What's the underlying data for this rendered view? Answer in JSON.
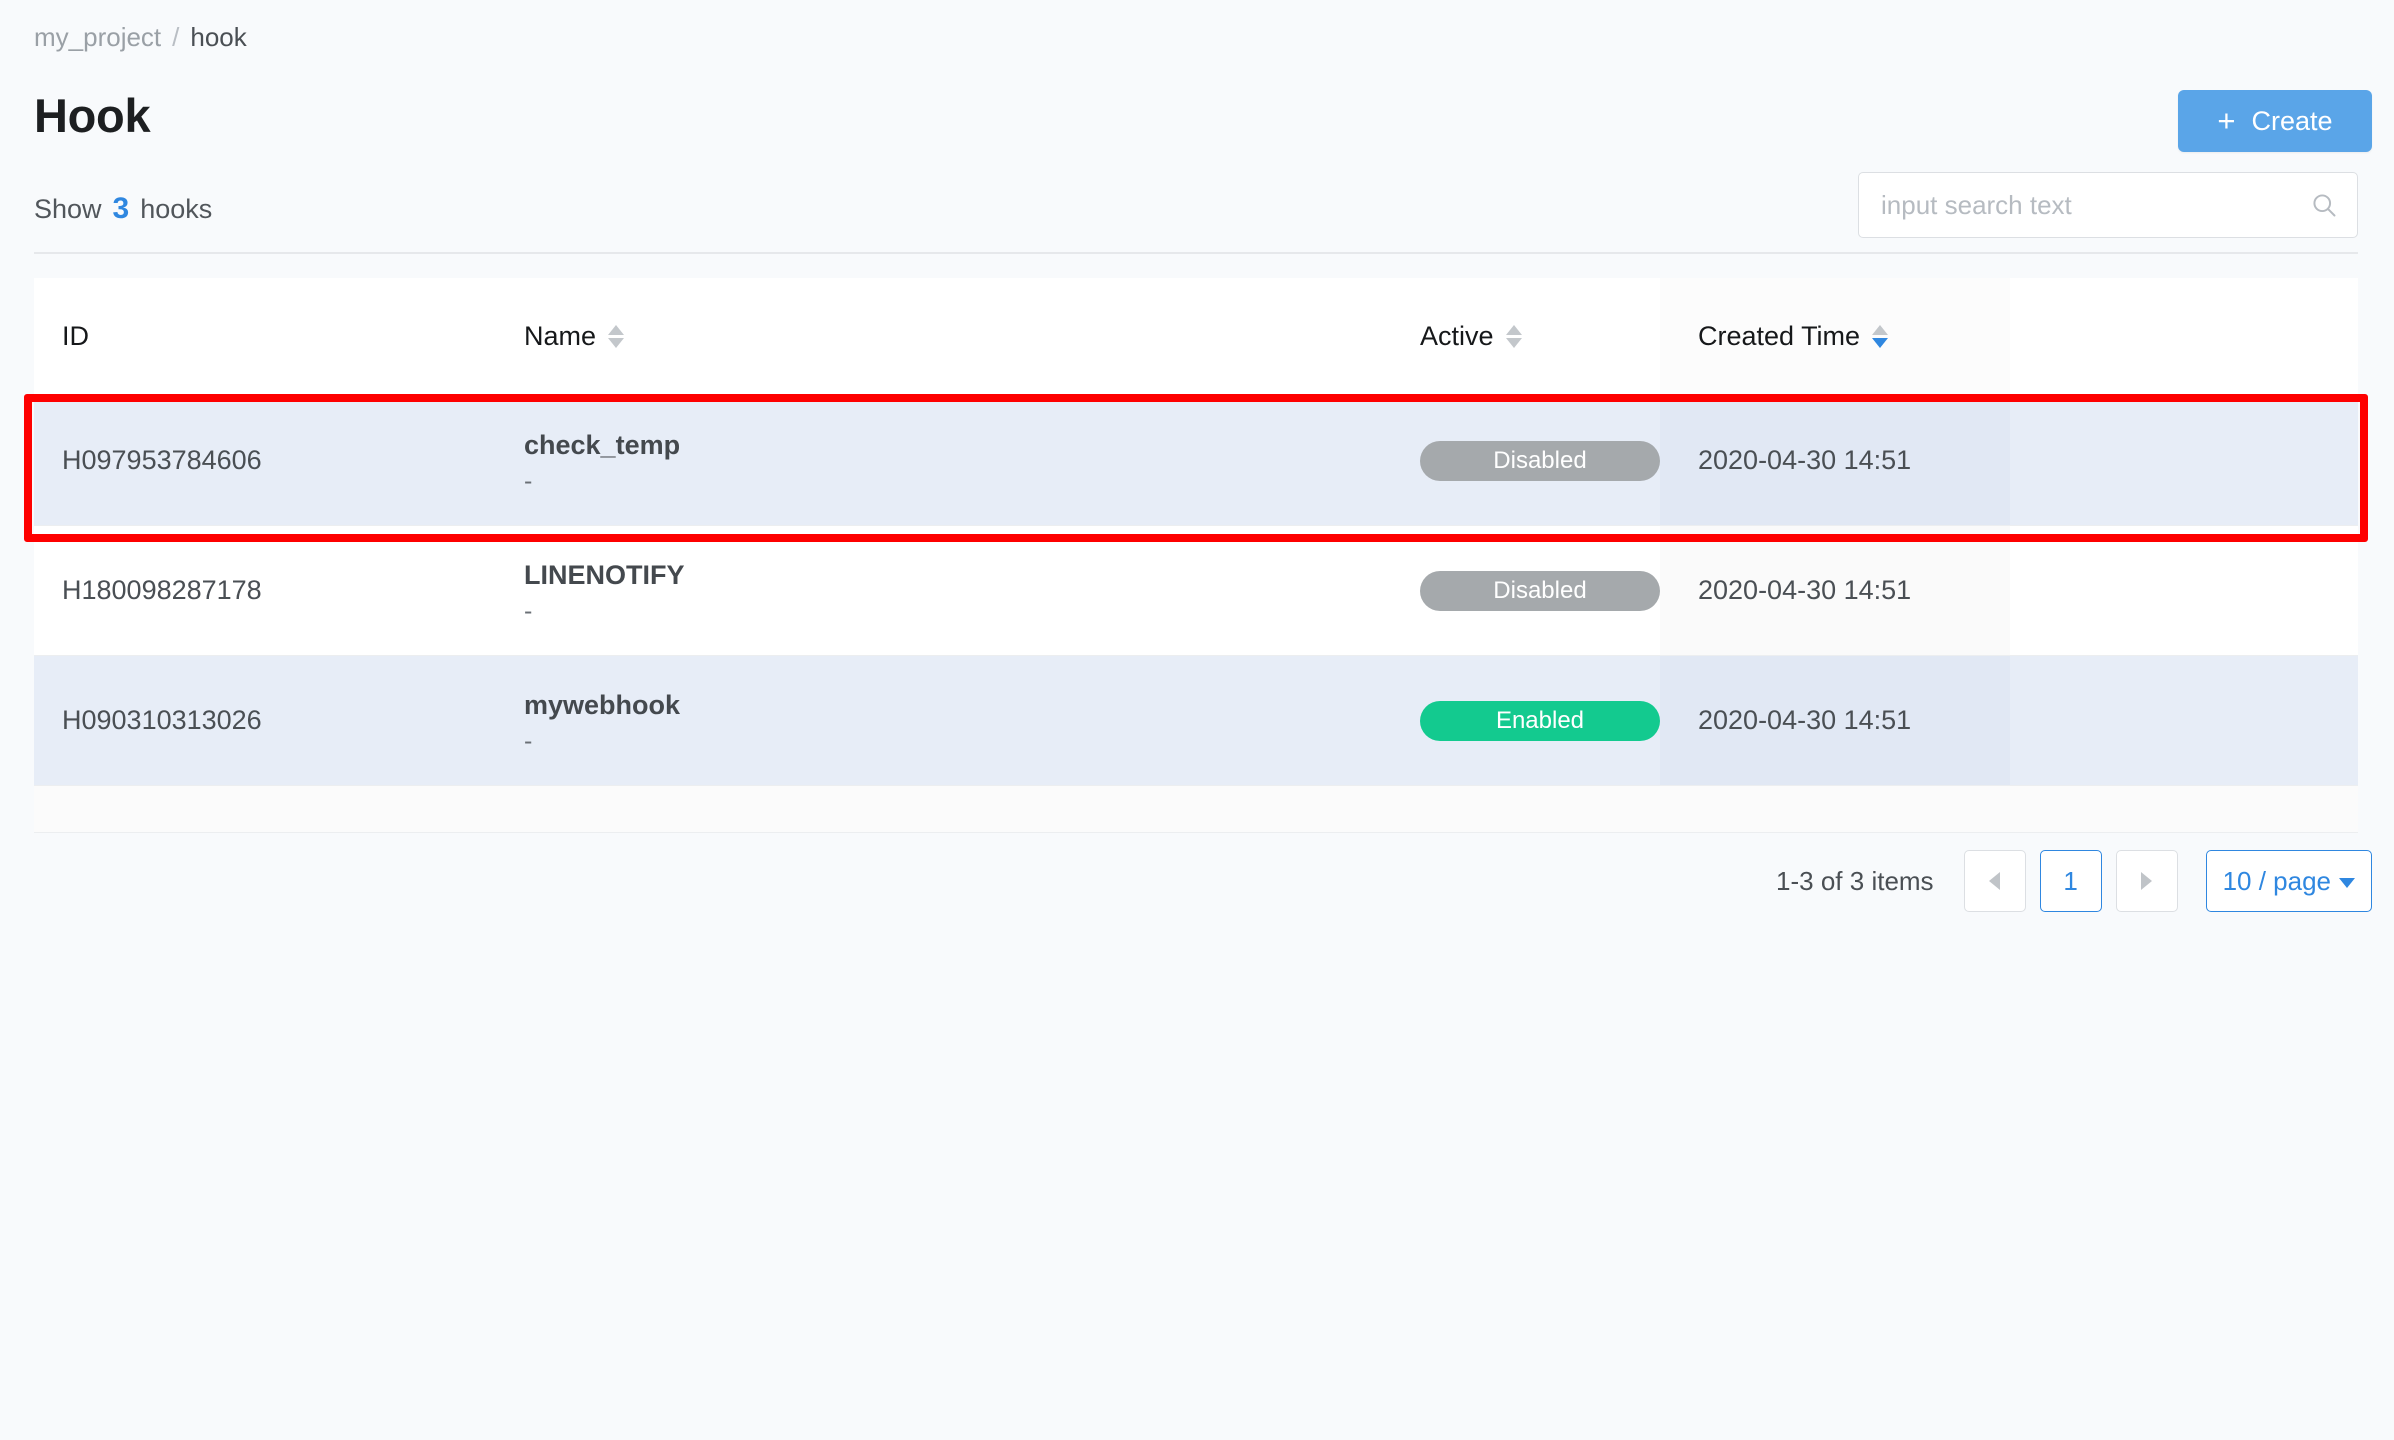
{
  "breadcrumb": {
    "root": "my_project",
    "separator": "/",
    "current": "hook"
  },
  "header": {
    "title": "Hook",
    "create_label": "Create",
    "create_icon": "plus-icon",
    "create_color": "#5aa5e8"
  },
  "summary": {
    "prefix": "Show",
    "count": "3",
    "suffix": "hooks",
    "count_color": "#2f87e0"
  },
  "search": {
    "value": "",
    "placeholder": "input search text",
    "icon": "search-icon"
  },
  "table": {
    "columns": [
      {
        "key": "id",
        "label": "ID",
        "sortable": false,
        "sort_state": "none"
      },
      {
        "key": "name",
        "label": "Name",
        "sortable": true,
        "sort_state": "none"
      },
      {
        "key": "active",
        "label": "Active",
        "sortable": true,
        "sort_state": "none"
      },
      {
        "key": "created_time",
        "label": "Created Time",
        "sortable": true,
        "sort_state": "desc"
      }
    ],
    "rows": [
      {
        "id": "H097953784606",
        "name": "check_temp",
        "description": "-",
        "active_label": "Disabled",
        "active_state": "disabled",
        "created_time": "2020-04-30 14:51",
        "highlighted": true,
        "annotated": true
      },
      {
        "id": "H180098287178",
        "name": "LINENOTIFY",
        "description": "-",
        "active_label": "Disabled",
        "active_state": "disabled",
        "created_time": "2020-04-30 14:51",
        "highlighted": false,
        "annotated": false
      },
      {
        "id": "H090310313026",
        "name": "mywebhook",
        "description": "-",
        "active_label": "Enabled",
        "active_state": "enabled",
        "created_time": "2020-04-30 14:51",
        "highlighted": true,
        "annotated": false
      }
    ]
  },
  "badge_colors": {
    "disabled": "#a5a9ac",
    "enabled": "#13ca8f"
  },
  "pagination": {
    "range_text": "1-3 of 3 items",
    "prev_icon": "chevron-left-icon",
    "next_icon": "chevron-right-icon",
    "current_page": "1",
    "page_size_label": "10 / page",
    "page_size_icon": "chevron-down-icon",
    "accent": "#2f87e0"
  },
  "annotation": {
    "color": "#fe0000",
    "target": "first-table-row"
  }
}
